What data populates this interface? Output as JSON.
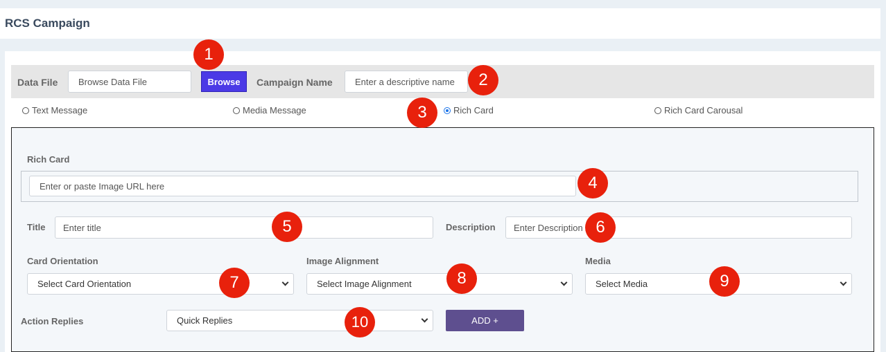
{
  "page": {
    "title": "RCS Campaign"
  },
  "toolbar": {
    "data_file_label": "Data File",
    "data_file_placeholder": "Browse Data File",
    "browse_label": "Browse",
    "campaign_name_label": "Campaign Name",
    "campaign_name_placeholder": "Enter a descriptive name"
  },
  "message_types": [
    {
      "label": "Text Message",
      "checked": false
    },
    {
      "label": "Media Message",
      "checked": false
    },
    {
      "label": "Rich Card",
      "checked": true
    },
    {
      "label": "Rich Card Carousal",
      "checked": false
    }
  ],
  "rich_card": {
    "section_label": "Rich Card",
    "image_url_placeholder": "Enter or paste Image URL here",
    "title_label": "Title",
    "title_placeholder": "Enter title",
    "description_label": "Description",
    "description_placeholder": "Enter Description",
    "card_orientation_label": "Card Orientation",
    "card_orientation_value": "Select Card Orientation",
    "image_alignment_label": "Image Alignment",
    "image_alignment_value": "Select Image Alignment",
    "media_label": "Media",
    "media_value": "Select Media",
    "action_replies_label": "Action Replies",
    "action_replies_value": "Quick Replies",
    "add_label": "ADD +"
  },
  "badges": [
    "1",
    "2",
    "3",
    "4",
    "5",
    "6",
    "7",
    "8",
    "9",
    "10"
  ],
  "colors": {
    "browse": "#4b3ae6",
    "add": "#5e4f8f",
    "badge": "#e8210c",
    "title": "#3a4a5e"
  }
}
